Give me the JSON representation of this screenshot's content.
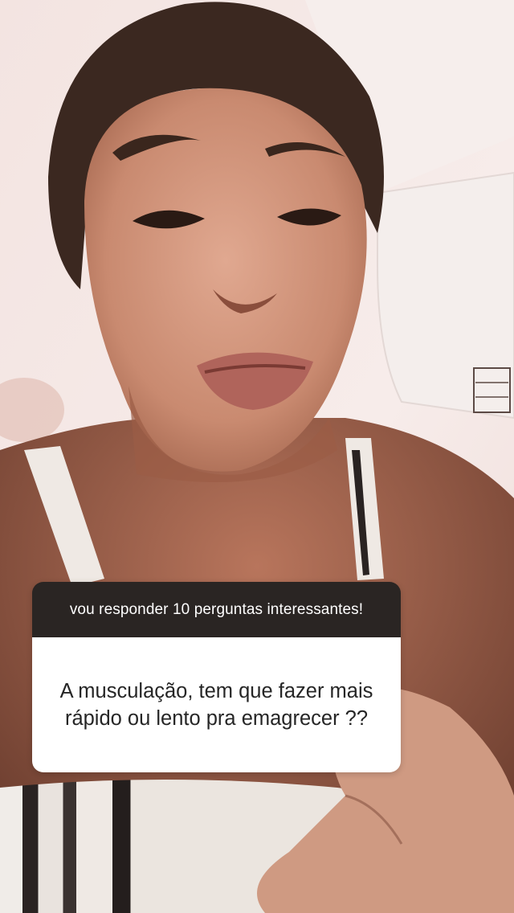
{
  "story": {
    "question_sticker": {
      "prompt": "vou responder 10 perguntas interessantes!",
      "question": "A musculação, tem que fazer mais rápido ou lento pra emagrecer ??"
    }
  },
  "colors": {
    "sticker_header": "#2a2523",
    "sticker_body": "#ffffff",
    "sticker_text": "#262626"
  }
}
